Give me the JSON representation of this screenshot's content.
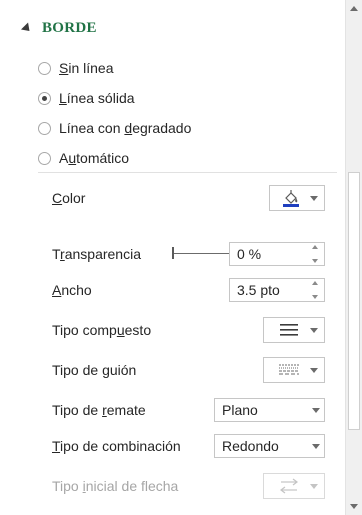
{
  "section": {
    "title": "BORDE",
    "expanded": true
  },
  "line_options": [
    {
      "pre": "",
      "u": "S",
      "post": "in línea",
      "checked": false
    },
    {
      "pre": "",
      "u": "L",
      "post": "ínea sólida",
      "checked": true
    },
    {
      "pre": "Línea con ",
      "u": "d",
      "post": "egradado",
      "checked": false
    },
    {
      "pre": "A",
      "u": "u",
      "post": "tomático",
      "checked": false
    }
  ],
  "properties": {
    "color": {
      "pre": "",
      "u": "C",
      "post": "olor",
      "swatch": "#1f3fbf",
      "icon": "paint-bucket-icon"
    },
    "transparency": {
      "pre": "T",
      "u": "r",
      "post": "ansparencia",
      "value": "0 %",
      "level": 0
    },
    "width": {
      "pre": "",
      "u": "A",
      "post": "ncho",
      "value": "3.5 pto"
    },
    "compound": {
      "pre": "Tipo comp",
      "u": "u",
      "post": "esto",
      "icon": "compound-lines-icon"
    },
    "dash": {
      "pre": "Tipo de ",
      "u": "g",
      "post": "uión",
      "icon": "dash-style-icon"
    },
    "cap": {
      "pre": "Tipo de ",
      "u": "r",
      "post": "emate",
      "value": "Plano"
    },
    "join": {
      "pre": "",
      "u": "T",
      "post": "ipo de combinación",
      "value": "Redondo"
    },
    "arrow_begin": {
      "pre": "Tipo ",
      "u": "i",
      "post": "nicial de flecha",
      "icon": "arrow-type-icon",
      "disabled": true
    }
  },
  "colors": {
    "section_title": "#217346",
    "disabled_text": "#a6a6a6"
  }
}
